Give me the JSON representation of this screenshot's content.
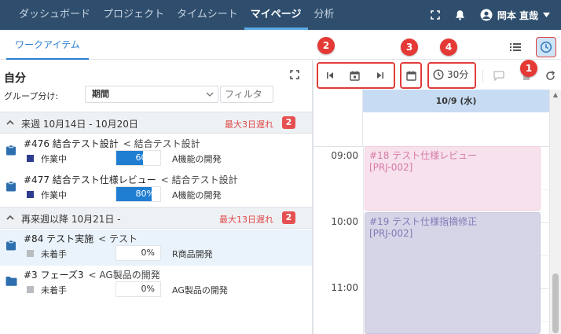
{
  "nav": {
    "items": [
      "ダッシュボード",
      "プロジェクト",
      "タイムシート",
      "マイページ",
      "分析"
    ],
    "active": "マイページ",
    "user_name": "岡本 直哉"
  },
  "tabs": {
    "work_items": "ワークアイテム"
  },
  "left": {
    "title": "自分",
    "group_label": "グループ分け:",
    "group_value": "期間",
    "filter_placeholder": "フィルタ",
    "groups": [
      {
        "label": "来週 10月14日 - 10月20日",
        "late": "最大3日遅れ",
        "count": "2",
        "items": [
          {
            "title": "#476 結合テスト設計",
            "parent": "< 結合テスト設計",
            "status": "作業中",
            "status_color": "#2e3d8f",
            "progress": 60,
            "progress_text": "60%",
            "project": "A機能の開発"
          },
          {
            "title": "#477 結合テスト仕様レビュー",
            "parent": "< 結合テスト設計",
            "status": "作業中",
            "status_color": "#2e3d8f",
            "progress": 80,
            "progress_text": "80%",
            "project": "A機能の開発"
          }
        ]
      },
      {
        "label": "再来週以降 10月21日 -",
        "late": "最大13日遅れ",
        "count": "2",
        "items": [
          {
            "title": "#84 テスト実施",
            "parent": "< テスト",
            "status": "未着手",
            "status_color": "#b9bcc0",
            "progress": 0,
            "progress_text": "0%",
            "project": "R商品開発"
          },
          {
            "title": "#3 フェーズ3",
            "parent": "< AG製品の開発",
            "status": "未着手",
            "status_color": "#b9bcc0",
            "progress": 0,
            "progress_text": "0%",
            "project": "AG製品の開発"
          }
        ]
      }
    ]
  },
  "right": {
    "duration": "30分",
    "day_header": "10/9 (水)",
    "hours": [
      "09:00",
      "10:00",
      "11:00"
    ],
    "events": [
      {
        "title": "#18 テスト仕様レビュー",
        "project": "[PRJ-002]"
      },
      {
        "title": "#19 テスト仕様指摘修正",
        "project": "[PRJ-002]"
      }
    ]
  },
  "callouts": [
    "1",
    "2",
    "3",
    "4"
  ],
  "colors": {
    "nav_bg": "#2f4e6e",
    "accent": "#2b7fd3",
    "late": "#e04848",
    "highlight": "#e23b3b"
  }
}
